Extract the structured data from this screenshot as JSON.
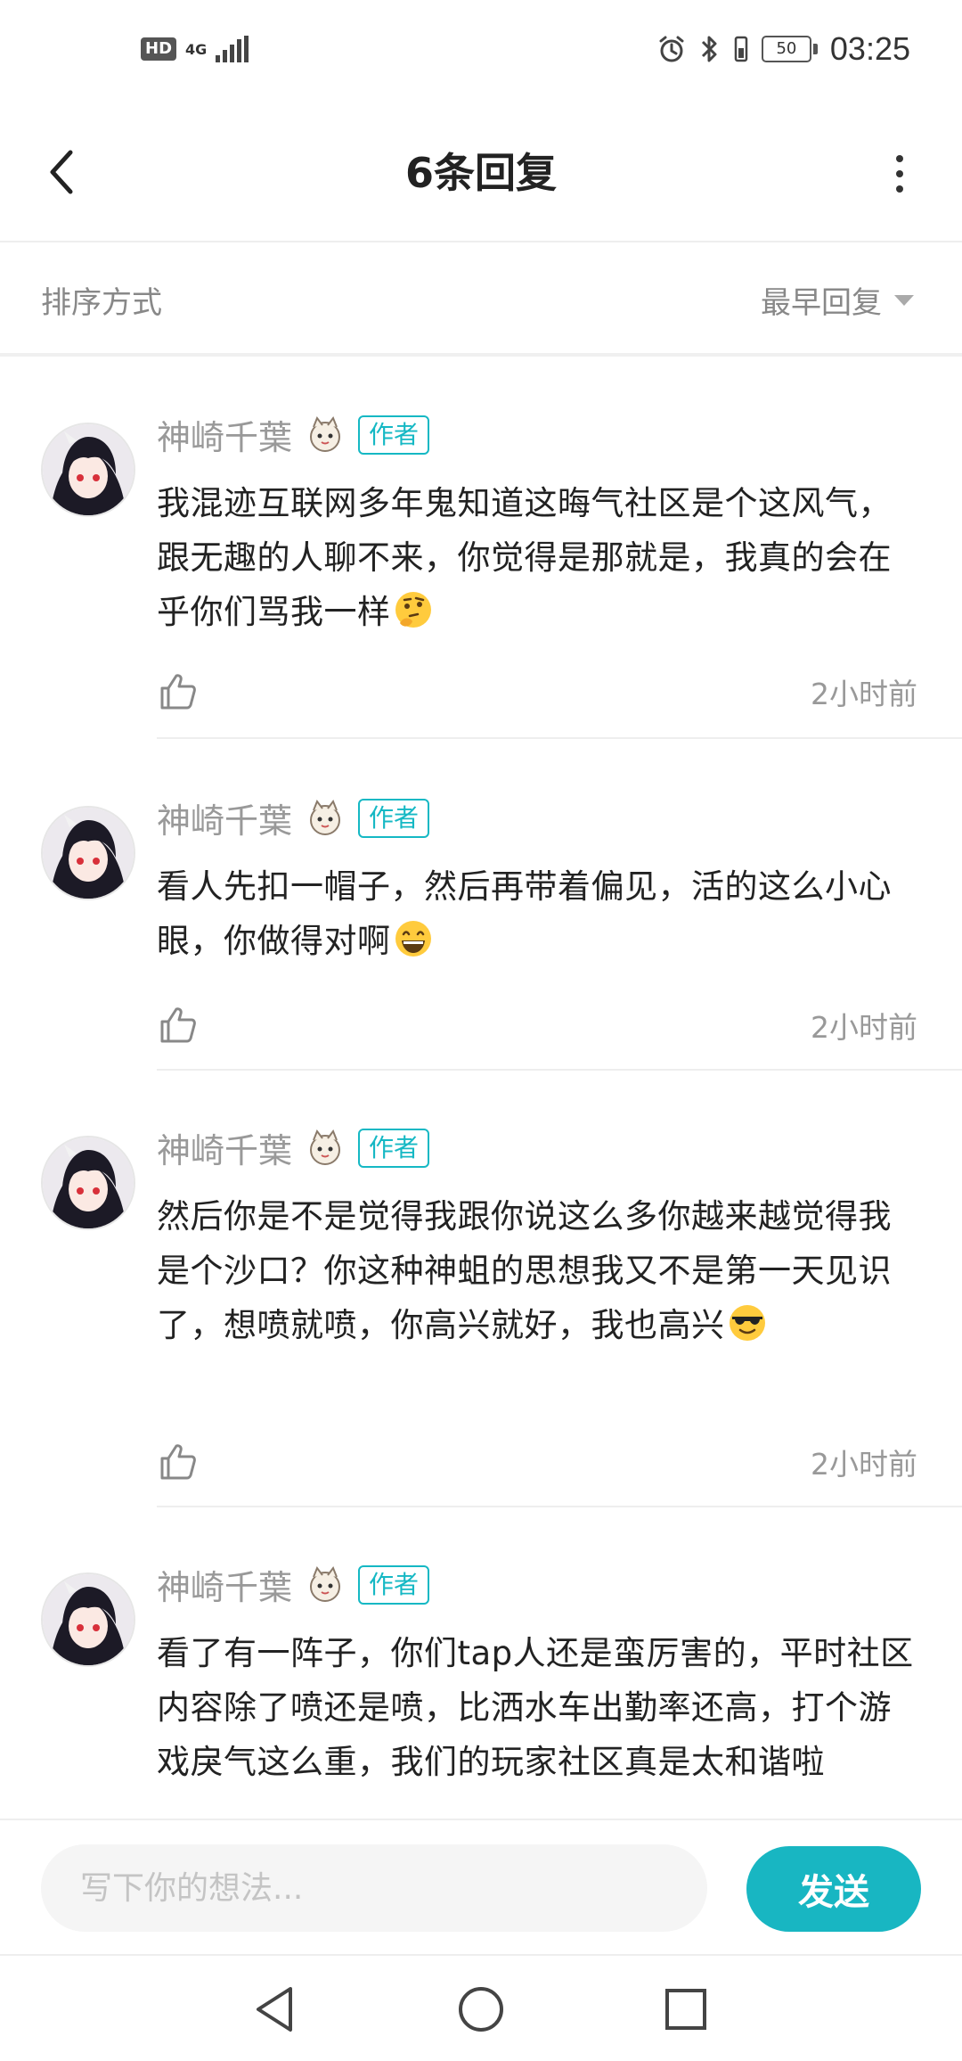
{
  "status_bar": {
    "hd": "HD",
    "network": "4G",
    "battery": "50",
    "time": "03:25"
  },
  "header": {
    "title": "6条回复",
    "back_icon": "chevron-left-icon",
    "more_icon": "more-vertical-icon"
  },
  "sort": {
    "label": "排序方式",
    "selected": "最早回复"
  },
  "comments": [
    {
      "name": "神崎千葉",
      "tag": "作者",
      "text": "我混迹互联网多年鬼知道这晦气社区是个这风气，跟无趣的人聊不来，你觉得是那就是，我真的会在乎你们骂我一样",
      "emoji": "thinking-face",
      "time": "2小时前"
    },
    {
      "name": "神崎千葉",
      "tag": "作者",
      "text": "看人先扣一帽子，然后再带着偏见，活的这么小心眼，你做得对啊",
      "emoji": "grinning-face",
      "time": "2小时前"
    },
    {
      "name": "神崎千葉",
      "tag": "作者",
      "text": "然后你是不是觉得我跟你说这么多你越来越觉得我是个沙口？你这种神蛆的思想我又不是第一天见识了，想喷就喷，你高兴就好，我也高兴",
      "emoji": "sunglasses-face",
      "time": "2小时前"
    },
    {
      "name": "神崎千葉",
      "tag": "作者",
      "text": "看了有一阵子，你们tap人还是蛮厉害的，平时社区内容除了喷还是喷，比洒水车出勤率还高，打个游戏戾气这么重，我们的玩家社区真是太和谐啦",
      "emoji": "",
      "time": ""
    }
  ],
  "composer": {
    "placeholder": "写下你的想法...",
    "send_label": "发送"
  },
  "colors": {
    "accent": "#18b6c2",
    "muted": "#999999"
  }
}
